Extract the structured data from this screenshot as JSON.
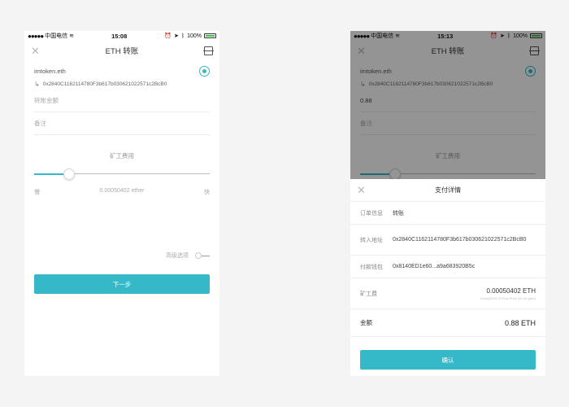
{
  "left": {
    "status": {
      "carrier": "中国电信",
      "time": "15:08",
      "battery": "100%"
    },
    "nav": {
      "title": "ETH 转账"
    },
    "ens": "imtoken.eth",
    "address": "0x2840C1162114780F3b617b030621022571c2BcB0",
    "amount_placeholder": "转账金额",
    "note_placeholder": "备注",
    "fee_label": "矿工费用",
    "slider_value": 0.2,
    "slow_label": "慢",
    "fee_value": "0.00050402 ether",
    "fast_label": "快",
    "advanced_label": "高级选项",
    "next_label": "下一步"
  },
  "right": {
    "status": {
      "carrier": "中国电信",
      "time": "15:13",
      "battery": "100%"
    },
    "nav": {
      "title": "ETH 转账"
    },
    "ens": "imtoken.eth",
    "address": "0x2840C1162114780F3b617b030621022571c2BcB0",
    "amount_value": "0.88",
    "note_placeholder": "备注",
    "fee_label": "矿工费用",
    "slider_value": 0.2,
    "sheet": {
      "title": "支付详情",
      "order_label": "订单信息",
      "order_value": "转账",
      "to_label": "转入地址",
      "to_value": "0x2840C1162114780F3b617b030621022571c2BcB0",
      "wallet_label": "付款钱包",
      "wallet_value": "0x8140ED1e60...a9a683920B5c",
      "fee_label": "矿工费",
      "fee_value": "0.00050402 ETH",
      "fee_detail": "≈Gas(25201.2)*Gas Price (20.00 gwei)",
      "amount_label": "金额",
      "amount_value": "0.88 ETH",
      "confirm_label": "确认"
    }
  },
  "colors": {
    "accent": "#35b8c8",
    "battery": "#3ec63e"
  }
}
